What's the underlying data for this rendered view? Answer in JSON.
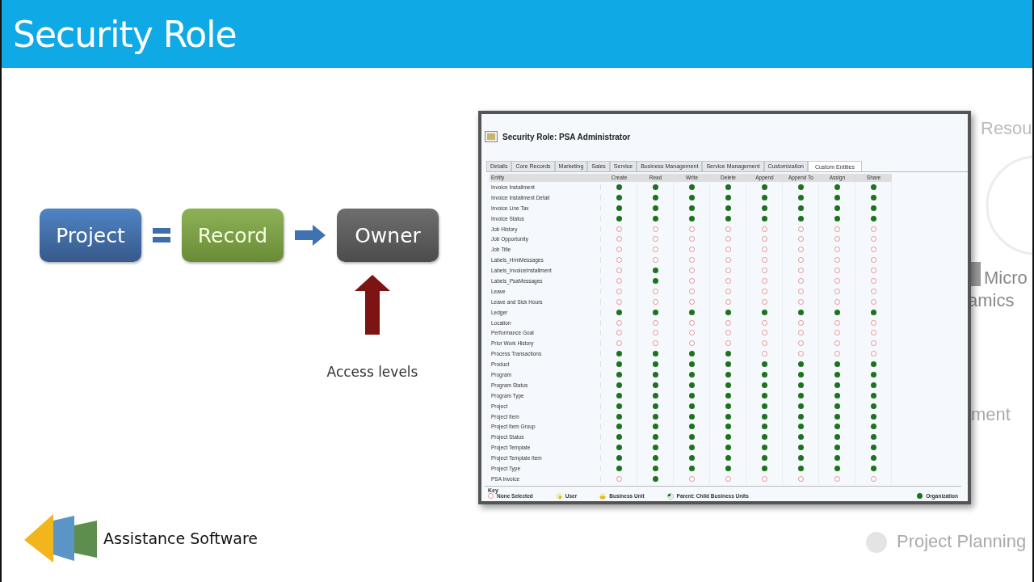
{
  "slide": {
    "title": "Security Role"
  },
  "diagram": {
    "boxes": [
      {
        "label": "Project",
        "kind": "project"
      },
      {
        "label": "Record",
        "kind": "record"
      },
      {
        "label": "Owner",
        "kind": "owner"
      }
    ],
    "note": "Access levels"
  },
  "logo": {
    "text": "Assistance Software"
  },
  "background_texts": [
    {
      "text": "Resou",
      "kind": "top"
    },
    {
      "text": "Micro",
      "kind": "mid1"
    },
    {
      "text": "amics",
      "kind": "mid2"
    },
    {
      "text": "ment",
      "kind": "low"
    },
    {
      "text": "Project Planning",
      "kind": "bottom"
    }
  ],
  "window": {
    "title": "Security Role: PSA Administrator",
    "tabs": [
      {
        "label": "Details",
        "selected": false
      },
      {
        "label": "Core Records",
        "selected": false
      },
      {
        "label": "Marketing",
        "selected": false
      },
      {
        "label": "Sales",
        "selected": false
      },
      {
        "label": "Service",
        "selected": false
      },
      {
        "label": "Business Management",
        "selected": false
      },
      {
        "label": "Service Management",
        "selected": false
      },
      {
        "label": "Customization",
        "selected": false
      },
      {
        "label": "Custom Entities",
        "selected": true
      }
    ],
    "columns": [
      "Entity",
      "Create",
      "Read",
      "Write",
      "Delete",
      "Append",
      "Append To",
      "Assign",
      "Share"
    ],
    "rows": [
      {
        "entity": "Invoice Installment",
        "access": [
          true,
          true,
          true,
          true,
          true,
          true,
          true,
          true
        ]
      },
      {
        "entity": "Invoice Installment Detail",
        "access": [
          true,
          true,
          true,
          true,
          true,
          true,
          true,
          true
        ]
      },
      {
        "entity": "Invoice Line Tax",
        "access": [
          true,
          true,
          true,
          true,
          true,
          true,
          true,
          true
        ]
      },
      {
        "entity": "Invoice Status",
        "access": [
          true,
          true,
          true,
          true,
          true,
          true,
          true,
          true
        ]
      },
      {
        "entity": "Job History",
        "access": [
          false,
          false,
          false,
          false,
          false,
          false,
          false,
          false
        ]
      },
      {
        "entity": "Job Opportunity",
        "access": [
          false,
          false,
          false,
          false,
          false,
          false,
          false,
          false
        ]
      },
      {
        "entity": "Job Title",
        "access": [
          false,
          false,
          false,
          false,
          false,
          false,
          false,
          false
        ]
      },
      {
        "entity": "Labels_HrmMessages",
        "access": [
          false,
          false,
          false,
          false,
          false,
          false,
          false,
          false
        ]
      },
      {
        "entity": "Labels_InvoiceInstallment",
        "access": [
          false,
          true,
          false,
          false,
          false,
          false,
          false,
          false
        ]
      },
      {
        "entity": "Labels_PsaMessages",
        "access": [
          false,
          true,
          false,
          false,
          false,
          false,
          false,
          false
        ]
      },
      {
        "entity": "Leave",
        "access": [
          false,
          false,
          false,
          false,
          false,
          false,
          false,
          false
        ]
      },
      {
        "entity": "Leave and Sick Hours",
        "access": [
          false,
          false,
          false,
          false,
          false,
          false,
          false,
          false
        ]
      },
      {
        "entity": "Ledger",
        "access": [
          true,
          true,
          true,
          true,
          true,
          true,
          true,
          true
        ]
      },
      {
        "entity": "Location",
        "access": [
          false,
          false,
          false,
          false,
          false,
          false,
          false,
          false
        ]
      },
      {
        "entity": "Performance Goal",
        "access": [
          false,
          false,
          false,
          false,
          false,
          false,
          false,
          false
        ]
      },
      {
        "entity": "Prior Work History",
        "access": [
          false,
          false,
          false,
          false,
          false,
          false,
          false,
          false
        ]
      },
      {
        "entity": "Process Transactions",
        "access": [
          true,
          true,
          true,
          true,
          false,
          false,
          false,
          false
        ]
      },
      {
        "entity": "Product",
        "access": [
          true,
          true,
          true,
          true,
          true,
          true,
          true,
          true
        ]
      },
      {
        "entity": "Program",
        "access": [
          true,
          true,
          true,
          true,
          true,
          true,
          true,
          true
        ]
      },
      {
        "entity": "Program Status",
        "access": [
          true,
          true,
          true,
          true,
          true,
          true,
          true,
          true
        ]
      },
      {
        "entity": "Program Type",
        "access": [
          true,
          true,
          true,
          true,
          true,
          true,
          true,
          true
        ]
      },
      {
        "entity": "Project",
        "access": [
          true,
          true,
          true,
          true,
          true,
          true,
          true,
          true
        ]
      },
      {
        "entity": "Project Item",
        "access": [
          true,
          true,
          true,
          true,
          true,
          true,
          true,
          true
        ]
      },
      {
        "entity": "Project Item Group",
        "access": [
          true,
          true,
          true,
          true,
          true,
          true,
          true,
          true
        ]
      },
      {
        "entity": "Project Status",
        "access": [
          true,
          true,
          true,
          true,
          true,
          true,
          true,
          true
        ]
      },
      {
        "entity": "Project Template",
        "access": [
          true,
          true,
          true,
          true,
          true,
          true,
          true,
          true
        ]
      },
      {
        "entity": "Project Template Item",
        "access": [
          true,
          true,
          true,
          true,
          true,
          true,
          true,
          true
        ]
      },
      {
        "entity": "Project Type",
        "access": [
          true,
          true,
          true,
          true,
          true,
          true,
          true,
          true
        ]
      },
      {
        "entity": "PSA Invoice",
        "access": [
          false,
          true,
          false,
          false,
          false,
          false,
          false,
          false
        ]
      }
    ],
    "key": {
      "title": "Key",
      "items": [
        {
          "label": "None Selected",
          "kind": "none"
        },
        {
          "label": "User",
          "kind": "user"
        },
        {
          "label": "Business Unit",
          "kind": "business_unit"
        },
        {
          "label": "Parent: Child Business Units",
          "kind": "parent_child"
        },
        {
          "label": "Organization",
          "kind": "organization"
        }
      ]
    }
  }
}
